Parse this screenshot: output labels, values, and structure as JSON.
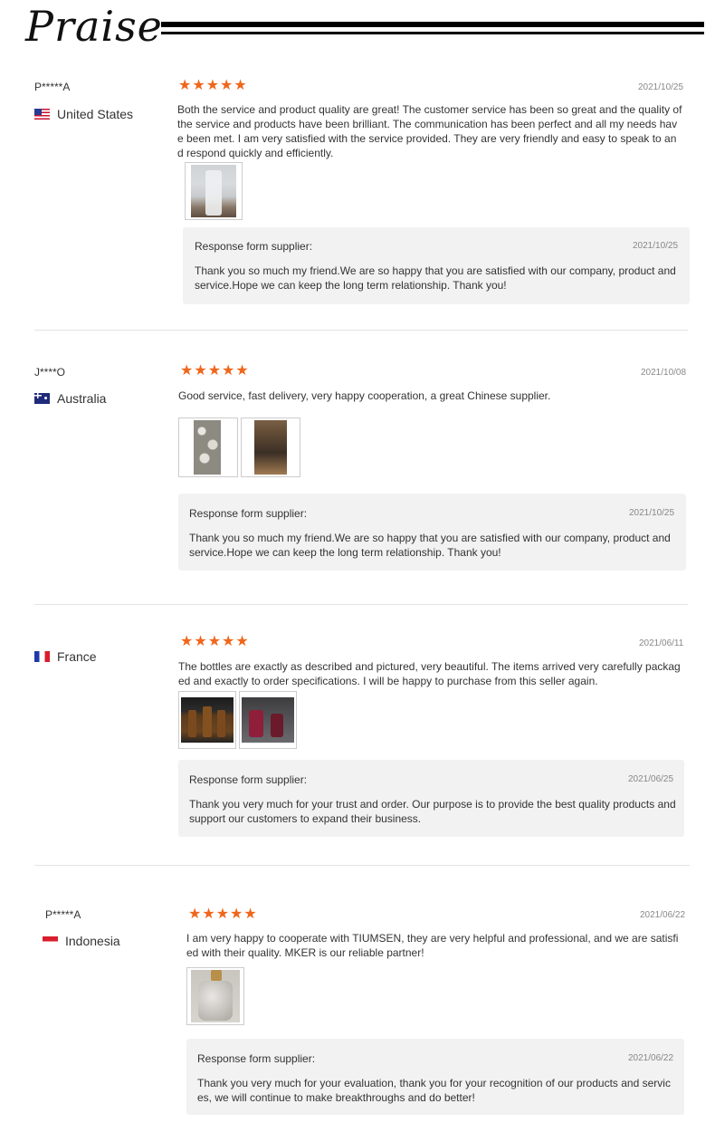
{
  "header": {
    "title": "Praise"
  },
  "reviews": [
    {
      "name": "P*****A",
      "country": "United States",
      "flag": "us-flag",
      "rating": 5,
      "date": "2021/10/25",
      "text": "Both the service and product quality are great! The customer service has been so great and the quality of the service and products have been brilliant. The communication has been perfect and all my needs have been met. I am very satisfied with the service provided. They are very friendly and easy to speak to and respond quickly and efficiently.",
      "photo_count": 1,
      "response": {
        "label": "Response form supplier:",
        "date": "2021/10/25",
        "text": "Thank you so much my friend.We are so happy that you are satisfied with our company, product and service.Hope we can keep the long term relationship. Thank you!"
      }
    },
    {
      "name": "J****O",
      "country": "Australia",
      "flag": "au-flag",
      "rating": 5,
      "date": "2021/10/08",
      "text": "Good service, fast delivery, very happy cooperation, a great Chinese supplier.",
      "photo_count": 2,
      "response": {
        "label": "Response form supplier:",
        "date": "2021/10/25",
        "text": "Thank you so much my friend.We are so happy that you are satisfied with our company, product and service.Hope we can keep the long term relationship. Thank you!"
      }
    },
    {
      "name": "",
      "country": "France",
      "flag": "fr-flag",
      "rating": 5,
      "date": "2021/06/11",
      "text": "The bottles are exactly as described and pictured, very beautiful. The items arrived very carefully packaged and exactly to order specifications. I will be happy to purchase from this seller again.",
      "photo_count": 2,
      "response": {
        "label": "Response form supplier:",
        "date": "2021/06/25",
        "text": "Thank you very much for your trust and order. Our purpose is to provide the best quality products and support our customers to expand their business."
      }
    },
    {
      "name": "P*****A",
      "country": "Indonesia",
      "flag": "id-flag",
      "rating": 5,
      "date": "2021/06/22",
      "text": "I am very happy to cooperate with TIUMSEN, they are very helpful and professional, and we are satisfied with their quality.  MKER  is our reliable partner!",
      "photo_count": 1,
      "response": {
        "label": "Response form supplier:",
        "date": "2021/06/22",
        "text": "Thank you very much for your evaluation, thank you for your recognition of our products and services, we will continue to make breakthroughs and do better!"
      }
    }
  ],
  "colors": {
    "star": "#f0661b",
    "response_bg": "#f2f2f2",
    "divider": "#e3e3e3"
  }
}
